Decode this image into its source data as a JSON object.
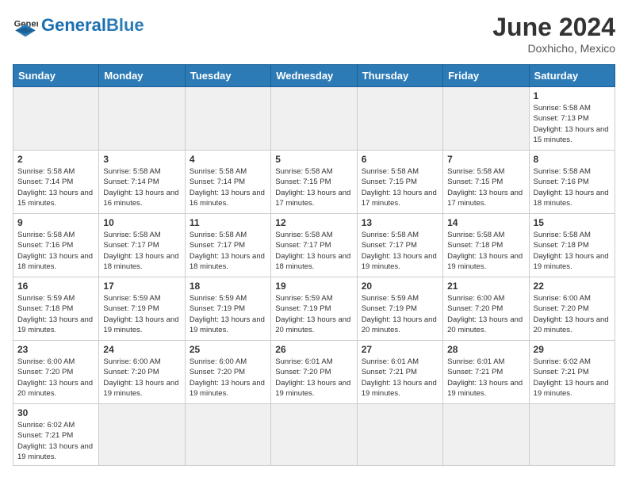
{
  "header": {
    "logo_general": "General",
    "logo_blue": "Blue",
    "month_year": "June 2024",
    "location": "Doxhicho, Mexico"
  },
  "weekdays": [
    "Sunday",
    "Monday",
    "Tuesday",
    "Wednesday",
    "Thursday",
    "Friday",
    "Saturday"
  ],
  "weeks": [
    [
      {
        "day": "",
        "empty": true
      },
      {
        "day": "",
        "empty": true
      },
      {
        "day": "",
        "empty": true
      },
      {
        "day": "",
        "empty": true
      },
      {
        "day": "",
        "empty": true
      },
      {
        "day": "",
        "empty": true
      },
      {
        "day": "1",
        "sunrise": "5:58 AM",
        "sunset": "7:13 PM",
        "daylight": "13 hours and 15 minutes."
      }
    ],
    [
      {
        "day": "2",
        "sunrise": "5:58 AM",
        "sunset": "7:14 PM",
        "daylight": "13 hours and 15 minutes."
      },
      {
        "day": "3",
        "sunrise": "5:58 AM",
        "sunset": "7:14 PM",
        "daylight": "13 hours and 16 minutes."
      },
      {
        "day": "4",
        "sunrise": "5:58 AM",
        "sunset": "7:14 PM",
        "daylight": "13 hours and 16 minutes."
      },
      {
        "day": "5",
        "sunrise": "5:58 AM",
        "sunset": "7:15 PM",
        "daylight": "13 hours and 17 minutes."
      },
      {
        "day": "6",
        "sunrise": "5:58 AM",
        "sunset": "7:15 PM",
        "daylight": "13 hours and 17 minutes."
      },
      {
        "day": "7",
        "sunrise": "5:58 AM",
        "sunset": "7:15 PM",
        "daylight": "13 hours and 17 minutes."
      },
      {
        "day": "8",
        "sunrise": "5:58 AM",
        "sunset": "7:16 PM",
        "daylight": "13 hours and 18 minutes."
      }
    ],
    [
      {
        "day": "9",
        "sunrise": "5:58 AM",
        "sunset": "7:16 PM",
        "daylight": "13 hours and 18 minutes."
      },
      {
        "day": "10",
        "sunrise": "5:58 AM",
        "sunset": "7:17 PM",
        "daylight": "13 hours and 18 minutes."
      },
      {
        "day": "11",
        "sunrise": "5:58 AM",
        "sunset": "7:17 PM",
        "daylight": "13 hours and 18 minutes."
      },
      {
        "day": "12",
        "sunrise": "5:58 AM",
        "sunset": "7:17 PM",
        "daylight": "13 hours and 18 minutes."
      },
      {
        "day": "13",
        "sunrise": "5:58 AM",
        "sunset": "7:17 PM",
        "daylight": "13 hours and 19 minutes."
      },
      {
        "day": "14",
        "sunrise": "5:58 AM",
        "sunset": "7:18 PM",
        "daylight": "13 hours and 19 minutes."
      },
      {
        "day": "15",
        "sunrise": "5:58 AM",
        "sunset": "7:18 PM",
        "daylight": "13 hours and 19 minutes."
      }
    ],
    [
      {
        "day": "16",
        "sunrise": "5:59 AM",
        "sunset": "7:18 PM",
        "daylight": "13 hours and 19 minutes."
      },
      {
        "day": "17",
        "sunrise": "5:59 AM",
        "sunset": "7:19 PM",
        "daylight": "13 hours and 19 minutes."
      },
      {
        "day": "18",
        "sunrise": "5:59 AM",
        "sunset": "7:19 PM",
        "daylight": "13 hours and 19 minutes."
      },
      {
        "day": "19",
        "sunrise": "5:59 AM",
        "sunset": "7:19 PM",
        "daylight": "13 hours and 20 minutes."
      },
      {
        "day": "20",
        "sunrise": "5:59 AM",
        "sunset": "7:19 PM",
        "daylight": "13 hours and 20 minutes."
      },
      {
        "day": "21",
        "sunrise": "6:00 AM",
        "sunset": "7:20 PM",
        "daylight": "13 hours and 20 minutes."
      },
      {
        "day": "22",
        "sunrise": "6:00 AM",
        "sunset": "7:20 PM",
        "daylight": "13 hours and 20 minutes."
      }
    ],
    [
      {
        "day": "23",
        "sunrise": "6:00 AM",
        "sunset": "7:20 PM",
        "daylight": "13 hours and 20 minutes."
      },
      {
        "day": "24",
        "sunrise": "6:00 AM",
        "sunset": "7:20 PM",
        "daylight": "13 hours and 19 minutes."
      },
      {
        "day": "25",
        "sunrise": "6:00 AM",
        "sunset": "7:20 PM",
        "daylight": "13 hours and 19 minutes."
      },
      {
        "day": "26",
        "sunrise": "6:01 AM",
        "sunset": "7:20 PM",
        "daylight": "13 hours and 19 minutes."
      },
      {
        "day": "27",
        "sunrise": "6:01 AM",
        "sunset": "7:21 PM",
        "daylight": "13 hours and 19 minutes."
      },
      {
        "day": "28",
        "sunrise": "6:01 AM",
        "sunset": "7:21 PM",
        "daylight": "13 hours and 19 minutes."
      },
      {
        "day": "29",
        "sunrise": "6:02 AM",
        "sunset": "7:21 PM",
        "daylight": "13 hours and 19 minutes."
      }
    ],
    [
      {
        "day": "30",
        "sunrise": "6:02 AM",
        "sunset": "7:21 PM",
        "daylight": "13 hours and 19 minutes."
      },
      {
        "day": "",
        "empty": true
      },
      {
        "day": "",
        "empty": true
      },
      {
        "day": "",
        "empty": true
      },
      {
        "day": "",
        "empty": true
      },
      {
        "day": "",
        "empty": true
      },
      {
        "day": "",
        "empty": true
      }
    ]
  ]
}
